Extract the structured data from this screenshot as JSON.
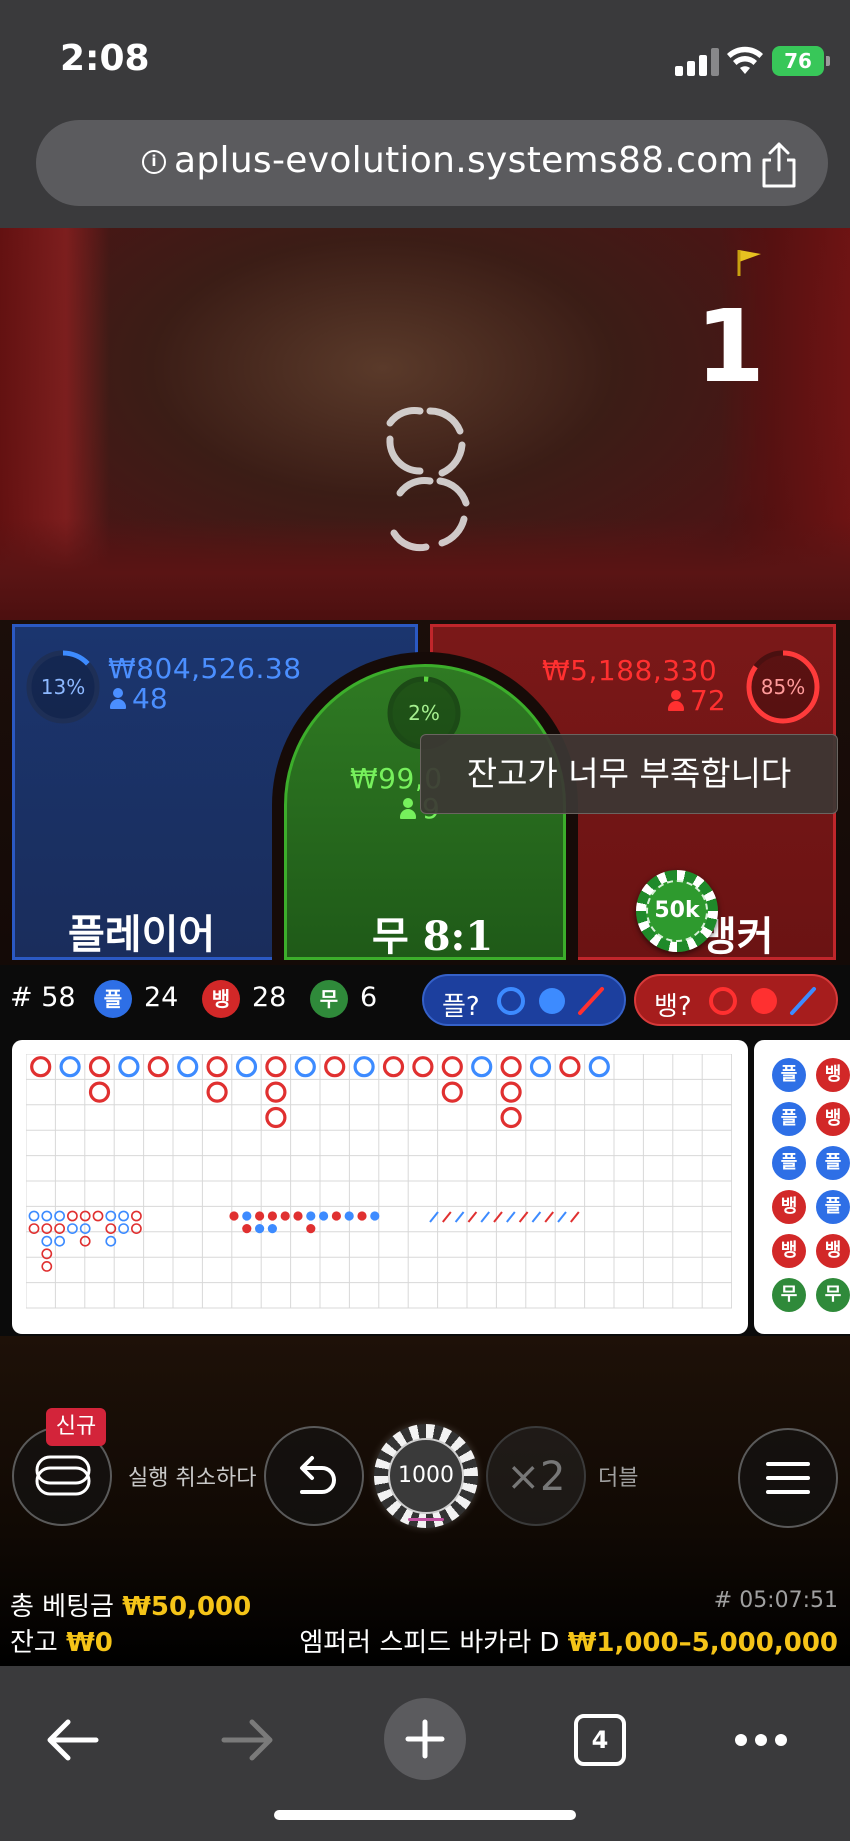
{
  "status_bar": {
    "time": "2:08",
    "battery": "76"
  },
  "browser": {
    "url": "aplus-evolution.systems88.com",
    "tab_count": "4"
  },
  "video": {
    "round_number": "1"
  },
  "bets": {
    "player": {
      "percent": "13%",
      "percent_value": 13,
      "amount": "₩804,526.38",
      "players": "48",
      "label": "플레이어"
    },
    "tie": {
      "percent": "2%",
      "percent_value": 2,
      "amount": "₩99,0",
      "players": "9",
      "label": "무 8:1"
    },
    "banker": {
      "percent": "85%",
      "percent_value": 85,
      "amount": "₩5,188,330",
      "players": "72",
      "label": "뱅커"
    }
  },
  "placed_chip": "50k",
  "toast": "잔고가 너무 부족합니다",
  "stats": {
    "round": "# 58",
    "player_badge": "플",
    "player_count": "24",
    "banker_badge": "뱅",
    "banker_count": "28",
    "tie_badge": "무",
    "tie_count": "6",
    "player_ask": "플?",
    "banker_ask": "뱅?"
  },
  "side_road": [
    "플",
    "플",
    "플",
    "뱅",
    "뱅",
    "무"
  ],
  "side_road_partial": [
    "뱅",
    "뱅",
    "플",
    "플",
    "뱅",
    "무"
  ],
  "controls": {
    "new_badge": "신규",
    "undo_label": "실행 취소하다",
    "chip_value": "1000",
    "double_symbol": "×2",
    "double_label": "더블"
  },
  "footer": {
    "total_bet_label": "총 베팅금",
    "total_bet_value": "₩50,000",
    "balance_label": "잔고",
    "balance_value": "₩0",
    "game_id": "# 05:07:51",
    "table_name": "엠퍼러 스피드 바카라 D",
    "limits": "₩1,000–5,000,000"
  },
  "colors": {
    "player": "#2b59c3",
    "banker": "#c0262b",
    "tie": "#3cae2b",
    "gold": "#f5c418"
  }
}
